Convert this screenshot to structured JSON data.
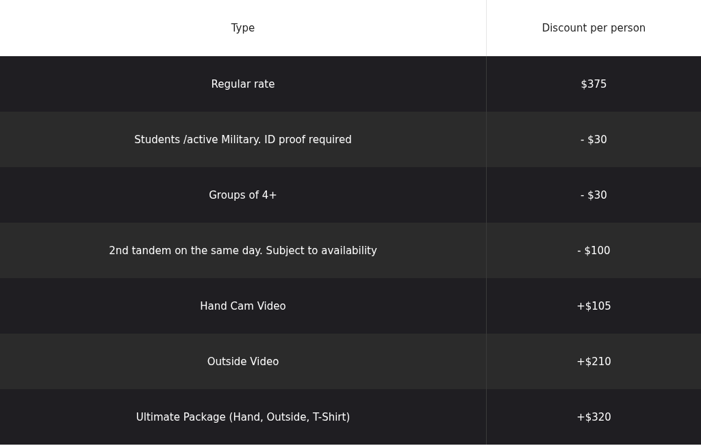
{
  "table": {
    "columns": [
      "Type",
      "Discount per person"
    ],
    "rows": [
      {
        "type": "Regular rate",
        "discount": "$375"
      },
      {
        "type": "Students /active Military. ID proof required",
        "discount": "- $30"
      },
      {
        "type": "Groups of 4+",
        "discount": "- $30"
      },
      {
        "type": "2nd tandem on the same day. Subject to availability",
        "discount": "- $100"
      },
      {
        "type": "Hand Cam Video",
        "discount": "+$105"
      },
      {
        "type": "Outside Video",
        "discount": "+$210"
      },
      {
        "type": "Ultimate Package (Hand, Outside, T-Shirt)",
        "discount": "+$320"
      }
    ]
  }
}
